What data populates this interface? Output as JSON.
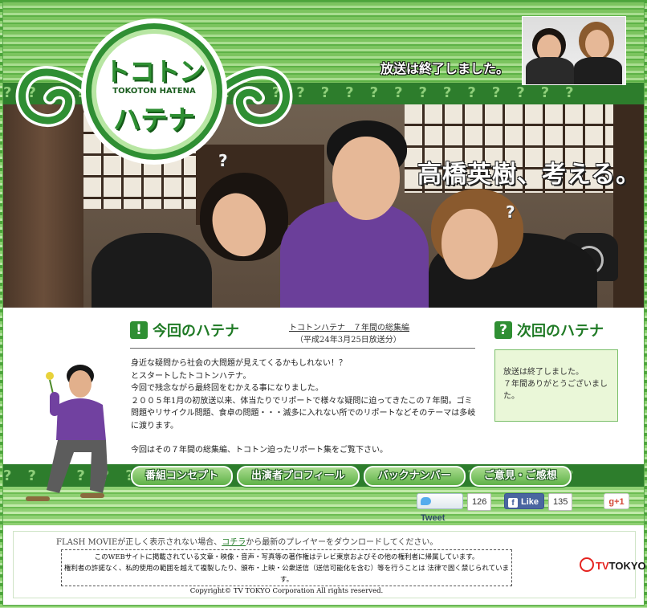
{
  "header": {
    "logo_text_top": "トコトン",
    "logo_text_latin": "TOKOTON HATENA",
    "logo_text_bottom": "ハテナ",
    "broadcast_status": "放送は終了しました。",
    "question_marks": "????????????????????????"
  },
  "hero": {
    "tagline": "高橋英樹、考える。"
  },
  "current": {
    "heading_icon": "!",
    "heading": "今回のハテナ",
    "episode_title": "トコトンハテナ　７年間の総集編",
    "episode_date": "（平成24年3月25日放送分）",
    "description": [
      "身近な疑問から社会の大問題が見えてくるかもしれない！？",
      "とスタートしたトコトンハテナ。",
      "今回で残念ながら最終回をむかえる事になりました。",
      "２００５年1月の初放送以来、体当たりでリポートで様々な疑問に迫ってきたこの７年間。ゴミ問題やリサイクル問題、食卓の問題・・・滅多に入れない所でのリポートなどそのテーマは多岐に渡ります。",
      "今回はその７年間の総集編、トコトン迫ったリポート集をご覧下さい。"
    ]
  },
  "next": {
    "heading_icon": "?",
    "heading": "次回のハテナ",
    "text_line1": "放送は終了しました。",
    "text_line2": "７年間ありがとうございました。"
  },
  "nav": {
    "items": [
      {
        "label": "番組コンセプト"
      },
      {
        "label": "出演者プロフィール"
      },
      {
        "label": "バックナンバー"
      },
      {
        "label": "ご意見・ご感想"
      }
    ]
  },
  "social": {
    "tweet_label": "Tweet",
    "tweet_count": "126",
    "like_label": "Like",
    "like_count": "135",
    "gplus_label": "g+1",
    "twitter_color": "#55acee",
    "facebook_color": "#4a66a0",
    "gplus_color": "#d34836"
  },
  "footer": {
    "flash_before": "FLASH MOVIEが正しく表示されない場合、",
    "flash_link": "コチラ",
    "flash_after": "から最新のプレイヤーをダウンロードしてください。",
    "copyright_line1": "このWEBサイトに掲載されている文章・映像・音声・写真等の著作権はテレビ東京およびその他の権利者に帰属しています。",
    "copyright_line2": "権利者の許諾なく、私的使用の範囲を越えて複製したり、頒布・上映・公衆送信（送信可能化を含む）等を行うことは 法律で固く禁じられています。",
    "copyright_line3": "Copyright© TV TOKYO Corporation All rights reserved.",
    "brand_tv": "TV",
    "brand_name": "TOKYO"
  },
  "colors": {
    "brand_green": "#2d7d2c",
    "heading_green": "#1f7a25",
    "stripe_light": "#a9dd90"
  }
}
